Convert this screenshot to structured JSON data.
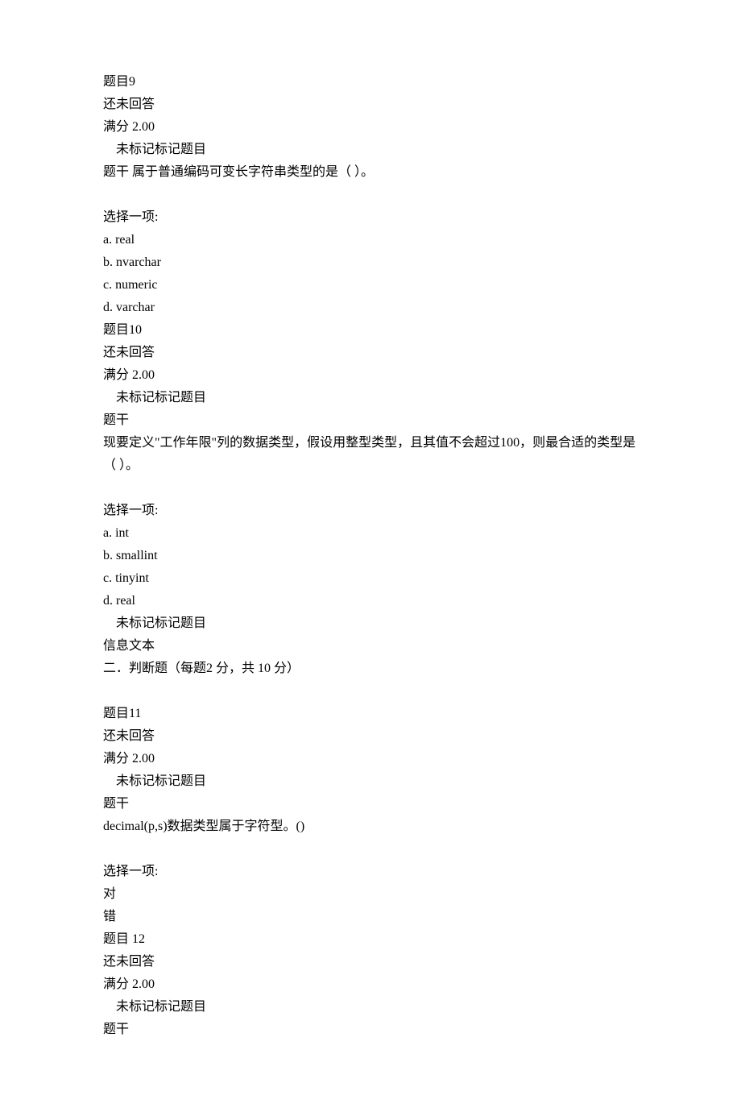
{
  "q9": {
    "title": "题目9",
    "status": "还未回答",
    "full_score": "满分 2.00",
    "flag": "未标记标记题目",
    "stem_label": "题干",
    "stem_text": "属于普通编码可变长字符串类型的是（ ）。",
    "choose_label": "选择一项:",
    "options": {
      "a": "a. real",
      "b": "b. nvarchar",
      "c": "c. numeric",
      "d": "d. varchar"
    }
  },
  "q10": {
    "title": "题目10",
    "status": "还未回答",
    "full_score": "满分 2.00",
    "flag": "未标记标记题目",
    "stem_label": "题干",
    "stem_text": "现要定义\"工作年限\"列的数据类型，假设用整型类型，且其值不会超过100，则最合适的类型是（ ）。",
    "choose_label": "选择一项:",
    "options": {
      "a": "a. int",
      "b": "b. smallint",
      "c": "c. tinyint",
      "d": "d. real"
    },
    "flag2": "未标记标记题目",
    "info_label": "信息文本",
    "section2": "二．判断题（每题2 分，共 10 分）"
  },
  "q11": {
    "title": "题目11",
    "status": "还未回答",
    "full_score": "满分 2.00",
    "flag": "未标记标记题目",
    "stem_label": "题干",
    "stem_text": "decimal(p,s)数据类型属于字符型。()",
    "choose_label": "选择一项:",
    "true": "对",
    "false": "错"
  },
  "q12": {
    "title": "题目 12",
    "status": "还未回答",
    "full_score": "满分 2.00",
    "flag": "未标记标记题目",
    "stem_label": "题干"
  }
}
